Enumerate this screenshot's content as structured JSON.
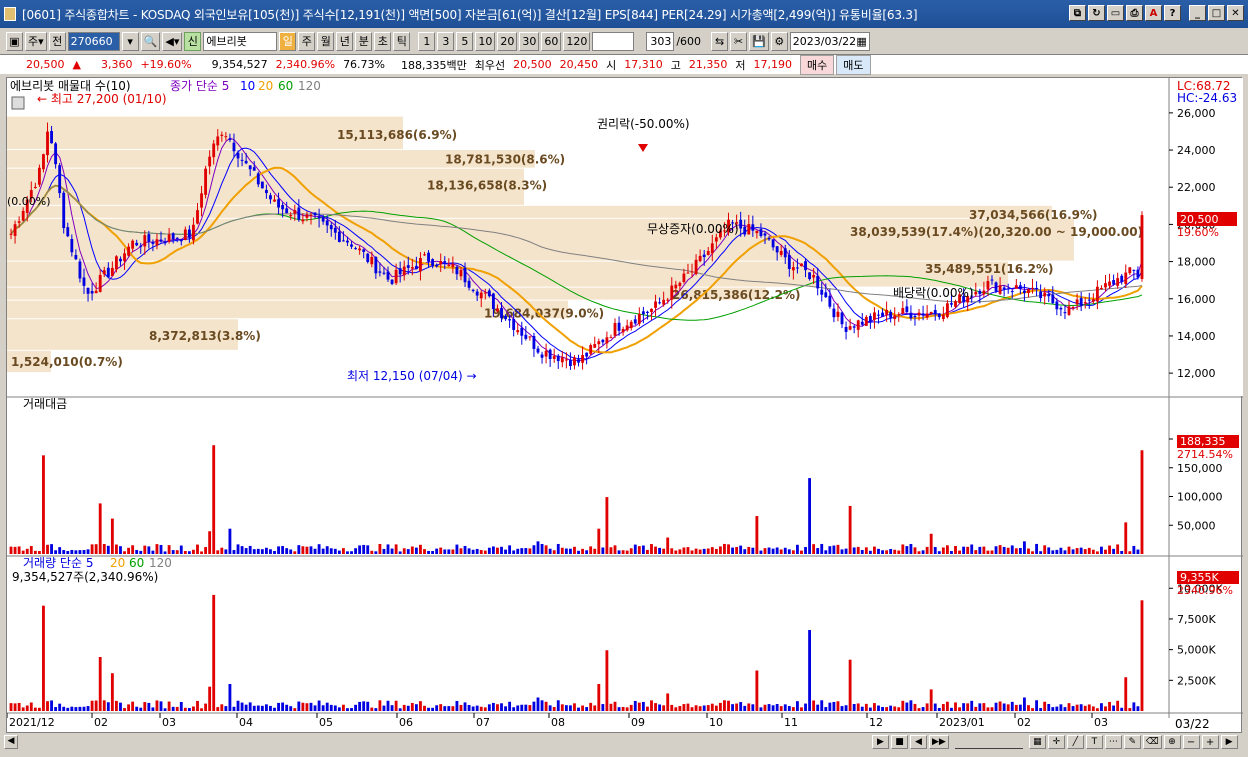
{
  "window": {
    "title": "[0601] 주식종합차트 - KOSDAQ 외국인보유[105(천)] 주식수[12,191(천)] 액면[500] 자본금[61(억)] 결산[12월] EPS[844] PER[24.29] 시가총액[2,499(억)] 유통비율[63.3]"
  },
  "toolbar": {
    "mode_label": "주",
    "prev_label": "전",
    "code": "270660",
    "market_tag": "신",
    "stock_name": "에브리봇",
    "period_day": "일",
    "period_week": "주",
    "period_month": "월",
    "period_year": "년",
    "period_min": "분",
    "period_sec": "초",
    "period_tick": "틱",
    "intervals": [
      "1",
      "3",
      "5",
      "10",
      "20",
      "30",
      "60",
      "120"
    ],
    "count": "303",
    "count_total": "/600",
    "date": "2023/03/22"
  },
  "quote": {
    "price": "20,500",
    "change": "3,360",
    "change_pct": "+19.60%",
    "volume": "9,354,527",
    "vol_pct": "2,340.96%",
    "ratio": "76.73%",
    "amount": "188,335백만",
    "best_label": "최우선",
    "ask": "20,500",
    "bid": "20,450",
    "open_label": "시",
    "open": "17,310",
    "high_label": "고",
    "high": "21,350",
    "low_label": "저",
    "low": "17,190",
    "buy_label": "매수",
    "sell_label": "매도"
  },
  "price_panel": {
    "legend_name": "에브리봇 매물대 수(10)",
    "ma_label": "종가 단순 5",
    "ma_periods": [
      "10",
      "20",
      "60",
      "120"
    ],
    "lc": "LC:68.72",
    "hc": "HC:-24.63",
    "max_label": "최고 27,200 (01/10)",
    "min_label": "최저 12,150 (07/04)",
    "rights_label": "권리락(-50.00%)",
    "bonus_label": "무상증자(0.00%)",
    "dividend_label": "배당락(0.00%)",
    "left_pct": "(0.00%)",
    "current_price": "20,500",
    "current_pct": "19.60%",
    "y_ticks": [
      "26,000",
      "24,000",
      "22,000",
      "20,000",
      "18,000",
      "16,000",
      "14,000",
      "12,000"
    ],
    "profile_labels": [
      "15,113,686(6.9%)",
      "18,781,530(8.6%)",
      "18,136,658(8.3%)",
      "37,034,566(16.9%)",
      "38,039,539(17.4%)(20,320.00 ~ 19,000.00)",
      "35,489,551(16.2%)",
      "26,815,386(12.2%)",
      "19,684,037(9.0%)",
      "8,372,813(3.8%)",
      "1,524,010(0.7%)"
    ]
  },
  "amount_panel": {
    "title": "거래대금",
    "y_ticks": [
      "200,000",
      "150,000",
      "100,000",
      "50,000"
    ],
    "current": "188,335",
    "current_pct": "2714.54%"
  },
  "volume_panel": {
    "title": "거래량 단순 5",
    "ma_periods": [
      "20",
      "60",
      "120"
    ],
    "sub": "9,354,527주(2,340.96%)",
    "y_ticks": [
      "10,000K",
      "7,500K",
      "5,000K",
      "2,500K"
    ],
    "current": "9,355K",
    "current_pct": "2340.96%"
  },
  "x_axis": {
    "labels": [
      "2021/12",
      "02",
      "03",
      "04",
      "05",
      "06",
      "07",
      "08",
      "09",
      "10",
      "11",
      "12",
      "2023/01",
      "02",
      "03"
    ],
    "right_label": "03/22"
  },
  "colors": {
    "up": "#e00000",
    "down": "#0000e0",
    "profile": "#f5e4cc",
    "ma5": "#8000c0",
    "ma10": "#0000ff",
    "ma20": "#f0a000",
    "ma60": "#00a000",
    "ma120": "#808080"
  }
}
